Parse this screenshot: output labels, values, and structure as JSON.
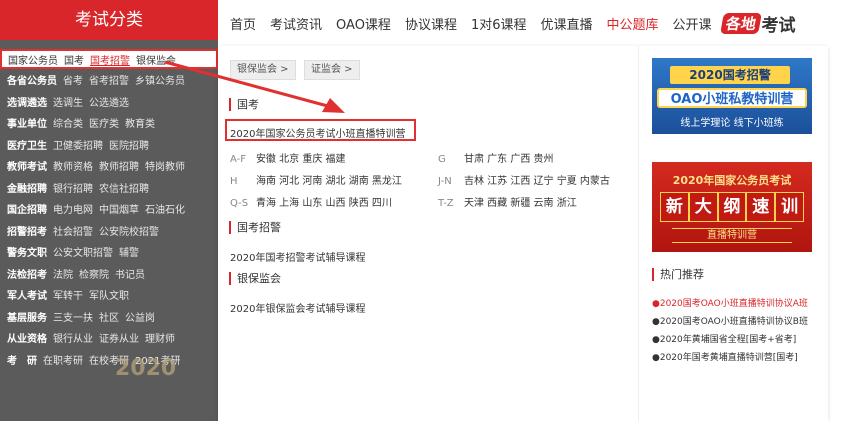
{
  "sidebar": {
    "title": "考试分类",
    "first_row": [
      {
        "label": "国家公务员",
        "active": false
      },
      {
        "label": "国考",
        "active": false
      },
      {
        "label": "国考招警",
        "active": true
      },
      {
        "label": "银保监会",
        "active": false
      }
    ],
    "rows": [
      {
        "cat": "各省公务员",
        "items": [
          "省考",
          "省考招警",
          "乡镇公务员"
        ]
      },
      {
        "cat": "选调遴选",
        "items": [
          "选调生",
          "公选遴选"
        ]
      },
      {
        "cat": "事业单位",
        "items": [
          "综合类",
          "医疗类",
          "教育类"
        ]
      },
      {
        "cat": "医疗卫生",
        "items": [
          "卫健委招聘",
          "医院招聘"
        ]
      },
      {
        "cat": "教师考试",
        "items": [
          "教师资格",
          "教师招聘",
          "特岗教师"
        ]
      },
      {
        "cat": "金融招聘",
        "items": [
          "银行招聘",
          "农信社招聘"
        ]
      },
      {
        "cat": "国企招聘",
        "items": [
          "电力电网",
          "中国烟草",
          "石油石化"
        ]
      },
      {
        "cat": "招警招考",
        "items": [
          "社会招警",
          "公安院校招警"
        ]
      },
      {
        "cat": "警务文职",
        "items": [
          "公安文职招警",
          "辅警"
        ]
      },
      {
        "cat": "法检招考",
        "items": [
          "法院",
          "检察院",
          "书记员"
        ]
      },
      {
        "cat": "军人考试",
        "items": [
          "军转干",
          "军队文职"
        ]
      },
      {
        "cat": "基层服务",
        "items": [
          "三支一扶",
          "社区",
          "公益岗"
        ]
      },
      {
        "cat": "从业资格",
        "items": [
          "银行从业",
          "证券从业",
          "理财师"
        ]
      },
      {
        "cat": "考　研",
        "items": [
          "在职考研",
          "在校考研",
          "2021考研"
        ]
      }
    ],
    "watermark": "2020"
  },
  "topnav": {
    "items": [
      {
        "label": "首页",
        "red": false
      },
      {
        "label": "考试资讯",
        "red": false
      },
      {
        "label": "OAO课程",
        "red": false
      },
      {
        "label": "协议课程",
        "red": false
      },
      {
        "label": "1对6课程",
        "red": false
      },
      {
        "label": "优课直播",
        "red": false
      },
      {
        "label": "中公题库",
        "red": true
      },
      {
        "label": "公开课",
        "red": false
      }
    ],
    "gedi_badge": "各地",
    "gedi_text": "考试"
  },
  "panel": {
    "tags": [
      "银保监会 >",
      "证监会 >"
    ],
    "section_guokao": "国考",
    "highlight_link": "2020年国家公务员考试小班直播特训营",
    "provinces": [
      {
        "letters": "A-F",
        "names": "安徽 北京 重庆 福建"
      },
      {
        "letters": "G",
        "names": "甘肃 广东 广西 贵州"
      },
      {
        "letters": "H",
        "names": "海南 河北 河南 湖北 湖南 黑龙江"
      },
      {
        "letters": "J-N",
        "names": "吉林 江苏 江西 辽宁 宁夏 内蒙古"
      },
      {
        "letters": "Q-S",
        "names": "青海 上海 山东 山西 陕西 四川"
      },
      {
        "letters": "T-Z",
        "names": "天津 西藏 新疆 云南 浙江"
      }
    ],
    "section_zhaojing": "国考招警",
    "zhaojing_link": "2020年国考招警考试辅导课程",
    "section_yinbao": "银保监会",
    "yinbao_link": "2020年银保监会考试辅导课程"
  },
  "banners": {
    "b1_title": "2020国考招警",
    "b1_main": "OAO小班私教特训营",
    "b1_sub": "线上学理论 线下小班练",
    "b2_title": "2020年国家公务员考试",
    "b2_chars": [
      "新",
      "大",
      "纲",
      "速",
      "训"
    ],
    "b2_sub": "直播特训营"
  },
  "hot": {
    "title": "热门推荐",
    "items": [
      "●2020国考OAO小班直播特训协议A班",
      "●2020国考OAO小班直播特训协议B班",
      "●2020年黄埔国省全程[国考+省考]",
      "●2020年国考黄埔直播特训营[国考]"
    ]
  },
  "colors": {
    "accent": "#d8262a",
    "sidebar_bg": "#5b5b5b",
    "banner_blue": "#1e64c8"
  }
}
